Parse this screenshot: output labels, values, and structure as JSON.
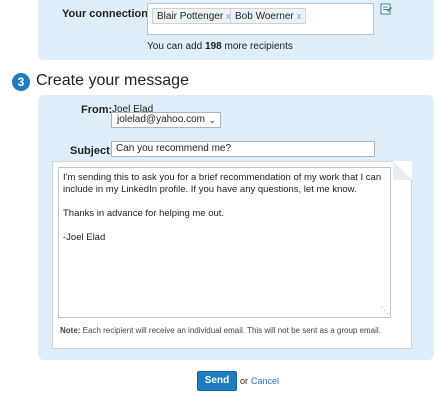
{
  "connections": {
    "label": "Your connections:",
    "recipients": [
      "Blair Pottenger",
      "Bob Woerner"
    ],
    "remove_glyph": "x",
    "remaining_prefix": "You can add ",
    "remaining_count": "198",
    "remaining_suffix": " more recipients",
    "address_book_icon": "address-book-icon"
  },
  "step": {
    "number": "3",
    "title": "Create your message"
  },
  "form": {
    "from_label": "From:",
    "from_name": "Joel Elad",
    "from_email": "jolelad@yahoo.com",
    "subject_label": "Subject:",
    "subject_value": "Can you recommend me?",
    "message_body": "I'm sending this to ask you for a brief recommendation of my work that I can\ninclude in my LinkedIn profile. If you have any questions, let me know.\n\nThanks in advance for helping me out.\n\n-Joel Elad",
    "note_label": "Note:",
    "note_text": " Each recipient will receive an individual email. This will not be sent as a group email."
  },
  "actions": {
    "send_label": "Send",
    "or_text": "or",
    "cancel_label": "Cancel"
  },
  "colors": {
    "panel": "#dfeef8",
    "accent": "#1f7cc1"
  }
}
